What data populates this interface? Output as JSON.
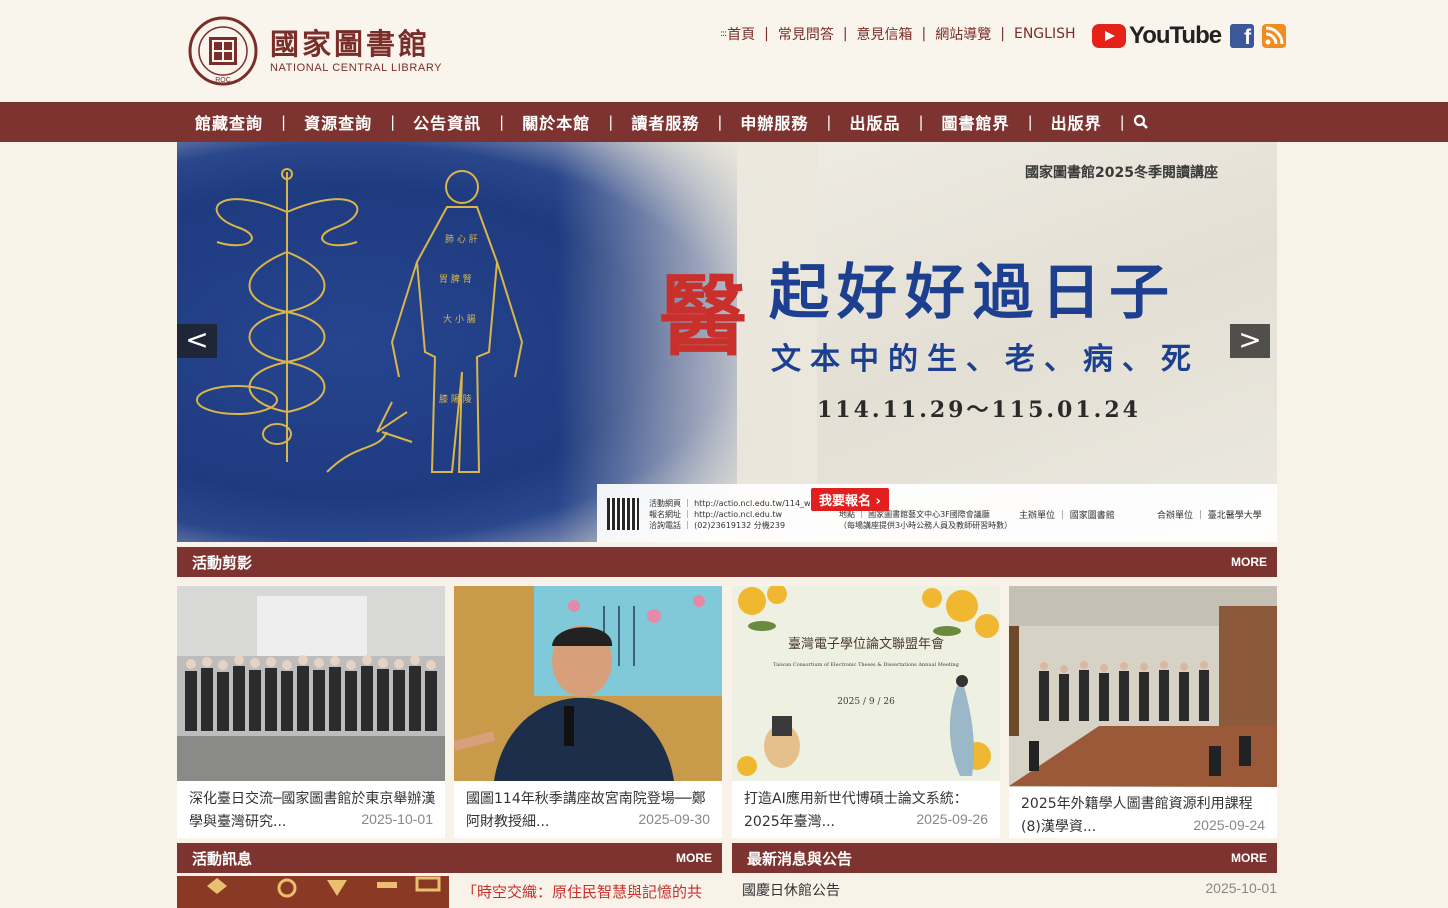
{
  "brand": {
    "name_zh": "國家圖書館",
    "name_en": "NATIONAL CENTRAL LIBRARY",
    "seal_text": "NATIONAL CENTRAL LIBRARY ROC 國圖"
  },
  "toplinks": [
    "首頁",
    "常見問答",
    "意見信箱",
    "網站導覽",
    "ENGLISH"
  ],
  "social": {
    "youtube_label": "YouTube",
    "facebook": "f"
  },
  "nav": [
    "館藏查詢",
    "資源查詢",
    "公告資訊",
    "關於本館",
    "讀者服務",
    "申辦服務",
    "出版品",
    "圖書館界",
    "出版界"
  ],
  "banner": {
    "subtitle": "國家圖書館2025冬季閱讀講座",
    "big_char": "醫",
    "title": "起好好過日子",
    "title2": "文本中的生、老、病、死",
    "dates": "114.11.29～115.01.24",
    "signup": "我要報名 ›",
    "info_lines": [
      "活動網頁 ｜ http://actio.ncl.edu.tw/114_winte",
      "報名網址 ｜ http://actio.ncl.edu.tw",
      "洽詢電話 ｜ (02)23619132 分機239"
    ],
    "info2_lines": [
      "0～16：30",
      "地點 ｜ 國家圖書館藝文中心3F國際會議廳",
      "（每場講座提供3小時公務人員及教師研習時數）"
    ],
    "org1": "主辦單位 ｜ 國家圖書館",
    "org2": "合辦單位 ｜ 臺北醫學大學",
    "prev": "<",
    "next": ">"
  },
  "sections": {
    "gallery": {
      "title": "活動剪影",
      "more": "MORE"
    },
    "events": {
      "title": "活動訊息",
      "more": "MORE"
    },
    "news": {
      "title": "最新消息與公告",
      "more": "MORE"
    }
  },
  "gallery": [
    {
      "caption": "深化臺日交流─國家圖書館於東京舉辦漢學與臺灣研究...",
      "date": "2025-10-01"
    },
    {
      "caption": "國圖114年秋季講座故宮南院登場──鄭阿財教授細...",
      "date": "2025-09-30"
    },
    {
      "caption": "打造AI應用新世代博碩士論文系統：2025年臺灣...",
      "date": "2025-09-26"
    },
    {
      "caption": "2025年外籍學人圖書館資源利用課程(8)漢學資...",
      "date": "2025-09-24"
    }
  ],
  "card3_image_text": {
    "line1": "臺灣電子學位論文聯盟年會",
    "line2": "Taiwan Consortium of Electronic Theses & Dissertations Annual Meeting",
    "line3": "2025 / 9 / 26"
  },
  "events_list": [
    {
      "text": "「時空交織：原住民智慧與記憶的共"
    }
  ],
  "news_list": [
    {
      "text": "國慶日休館公告",
      "date": "2025-10-01"
    }
  ],
  "colors": {
    "brand": "#7d3430",
    "background": "#f8f2e9",
    "banner_blue": "#1f3b80",
    "accent_red": "#c9302c"
  }
}
